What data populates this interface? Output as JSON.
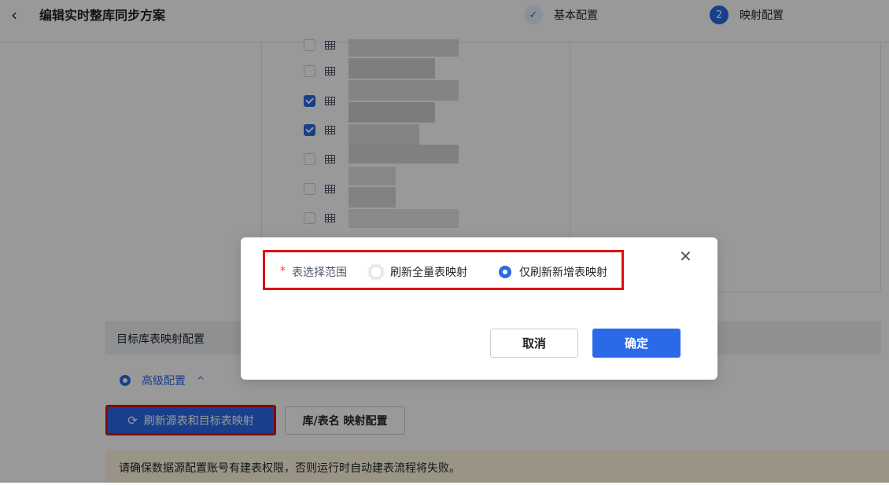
{
  "header": {
    "back_icon": "chevron-left-icon",
    "back_glyph": "‹",
    "title": "编辑实时整库同步方案",
    "steps": [
      {
        "indicator": "✓",
        "label": "基本配置",
        "status": "done"
      },
      {
        "indicator": "2",
        "label": "映射配置",
        "status": "active"
      }
    ]
  },
  "table_list": {
    "rows": [
      {
        "checked": false
      },
      {
        "checked": false
      },
      {
        "checked": true
      },
      {
        "checked": true
      },
      {
        "checked": false
      },
      {
        "checked": false
      },
      {
        "checked": false
      }
    ]
  },
  "target_section": {
    "title": "目标库表映射配置",
    "advanced_label": "高级配置",
    "advanced_caret": "^",
    "refresh_button": "刷新源表和目标表映射",
    "refresh_glyph": "⟳",
    "mapping_button": "库/表名 映射配置",
    "warning": "请确保数据源配置账号有建表权限，否则运行时自动建表流程将失败。"
  },
  "modal": {
    "required_mark": "*",
    "field_label": "表选择范围",
    "options": [
      {
        "label": "刷新全量表映射",
        "selected": false
      },
      {
        "label": "仅刷新新增表映射",
        "selected": true
      }
    ],
    "close_glyph": "✕",
    "cancel_label": "取消",
    "confirm_label": "确定"
  },
  "colors": {
    "primary": "#2a6ae9",
    "highlight_border": "#dd1111",
    "required": "#f53f3f",
    "warning_bg": "#fff7e0"
  }
}
